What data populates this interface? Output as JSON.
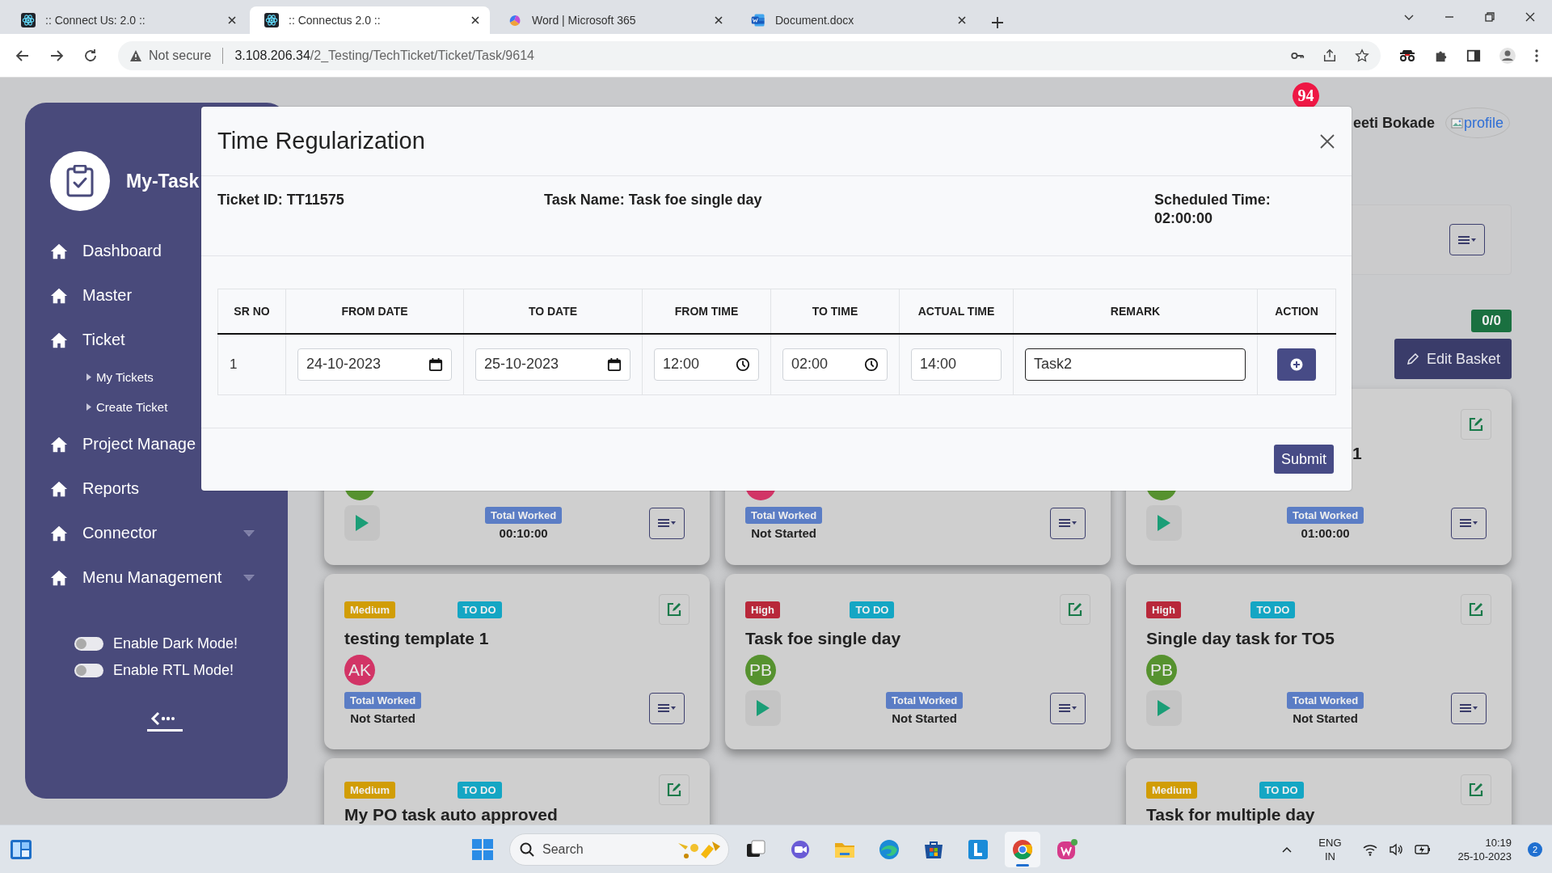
{
  "browser": {
    "tabs": [
      {
        "kind": "react",
        "title": ":: Connect Us: 2.0 ::",
        "selected": false
      },
      {
        "kind": "react",
        "title": ":: Connectus 2.0 ::",
        "selected": true
      },
      {
        "kind": "copilot",
        "title": "Word | Microsoft 365",
        "selected": false
      },
      {
        "kind": "word",
        "title": "Document.docx",
        "selected": false
      }
    ],
    "security": "Not secure",
    "url_host": "3.108.206.34",
    "url_path": "/2_Testing/TechTicket/Ticket/Task/9614"
  },
  "sidebar": {
    "brand": "My-Task",
    "items": [
      {
        "label": "Dashboard",
        "dropdown": false
      },
      {
        "label": "Master",
        "dropdown": false
      },
      {
        "label": "Ticket",
        "dropdown": false,
        "children": [
          {
            "label": "My Tickets"
          },
          {
            "label": "Create Ticket"
          }
        ]
      },
      {
        "label": "Project Manage",
        "dropdown": false
      },
      {
        "label": "Reports",
        "dropdown": false
      },
      {
        "label": "Connector",
        "dropdown": true
      },
      {
        "label": "Menu Management",
        "dropdown": true
      }
    ],
    "toggles": [
      {
        "label": "Enable Dark Mode!",
        "on": false
      },
      {
        "label": "Enable RTL Mode!",
        "on": false
      }
    ]
  },
  "header": {
    "notifications": "94",
    "user_name": "eeti Bokade",
    "profile_alt": "profile"
  },
  "board": {
    "basket_count": "0/0",
    "edit_basket": "Edit Basket",
    "columns": [
      {
        "cards": [
          {
            "kind": "partial",
            "avatar": {
              "color": "#56922f"
            },
            "play": true,
            "worked_label": "Total Worked",
            "worked": "00:10:00"
          },
          {
            "kind": "full",
            "priority": {
              "label": "Medium",
              "color": "#d19d06"
            },
            "status": "TO DO",
            "title": "testing template 1",
            "avatar": {
              "initials": "AK",
              "color": "#d23466"
            },
            "play": false,
            "worked_label": "Total Worked",
            "worked": "Not Started"
          },
          {
            "kind": "full",
            "priority": {
              "label": "Medium",
              "color": "#d19d06"
            },
            "status": "TO DO",
            "title": "My PO task auto approved"
          }
        ]
      },
      {
        "cards": [
          {
            "kind": "partial",
            "avatar": {
              "color": "#d23466"
            },
            "play": false,
            "worked_label": "Total Worked",
            "worked": "Not Started"
          },
          {
            "kind": "full",
            "priority": {
              "label": "High",
              "color": "#b8283a"
            },
            "status": "TO DO",
            "title": "Task foe single day",
            "avatar": {
              "initials": "PB",
              "color": "#56922f"
            },
            "play": true,
            "worked_label": "Total Worked",
            "worked": "Not Started"
          }
        ]
      },
      {
        "cards": [
          {
            "kind": "partial",
            "title": "1",
            "avatar": {
              "color": "#56922f"
            },
            "play": true,
            "worked_label": "Total Worked",
            "worked": "01:00:00"
          },
          {
            "kind": "full",
            "priority": {
              "label": "High",
              "color": "#b8283a"
            },
            "status": "TO DO",
            "title": "Single day task for TO5",
            "avatar": {
              "initials": "PB",
              "color": "#56922f"
            },
            "play": true,
            "worked_label": "Total Worked",
            "worked": "Not Started"
          },
          {
            "kind": "full",
            "priority": {
              "label": "Medium",
              "color": "#d19d06"
            },
            "status": "TO DO",
            "title": "Task for multiple day"
          }
        ]
      }
    ]
  },
  "modal": {
    "title": "Time Regularization",
    "ticket_id": "Ticket ID: TT11575",
    "task_name": "Task Name: Task foe single day",
    "scheduled": "Scheduled Time: 02:00:00",
    "columns": [
      "SR NO",
      "FROM DATE",
      "TO DATE",
      "FROM TIME",
      "TO TIME",
      "ACTUAL TIME",
      "REMARK",
      "ACTION"
    ],
    "rows": [
      {
        "sr": "1",
        "from_date": "24-10-2023",
        "to_date": "25-10-2023",
        "from_time": "12:00",
        "to_time": "02:00",
        "actual_time": "14:00",
        "remark": "Task2"
      }
    ],
    "submit": "Submit"
  },
  "taskbar": {
    "search_placeholder": "Search",
    "apps": [
      {
        "kind": "taskview",
        "selected": false
      },
      {
        "kind": "teams",
        "selected": false
      },
      {
        "kind": "explorer",
        "selected": false
      },
      {
        "kind": "edge",
        "selected": false
      },
      {
        "kind": "store",
        "selected": false
      },
      {
        "kind": "lapp",
        "selected": false
      },
      {
        "kind": "chrome",
        "selected": true
      },
      {
        "kind": "wapp",
        "selected": false
      }
    ],
    "language": "ENG",
    "region": "IN",
    "time": "10:19",
    "date": "25-10-2023",
    "notifications": "2"
  }
}
